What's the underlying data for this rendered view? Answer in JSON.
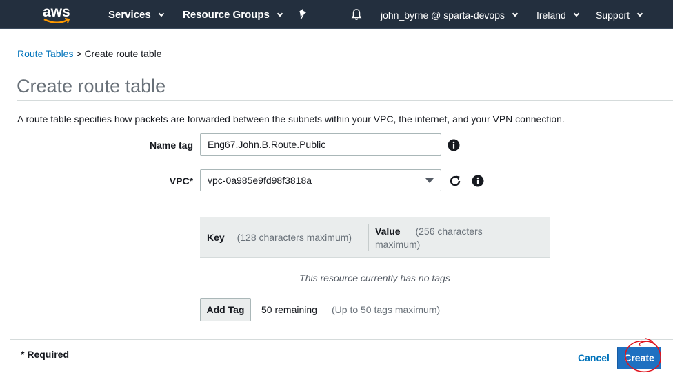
{
  "nav": {
    "logo_text": "aws",
    "services": "Services",
    "resource_groups": "Resource Groups",
    "pin_icon": "pin-icon",
    "bell_icon": "bell-icon",
    "account": "john_byrne @ sparta-devops",
    "region": "Ireland",
    "support": "Support"
  },
  "breadcrumb": {
    "parent": "Route Tables",
    "separator": ">",
    "current": "Create route table"
  },
  "page": {
    "title": "Create route table",
    "description": "A route table specifies how packets are forwarded between the subnets within your VPC, the internet, and your VPN connection."
  },
  "form": {
    "name_tag_label": "Name tag",
    "name_tag_value": "Eng67.John.B.Route.Public",
    "vpc_label": "VPC*",
    "vpc_value": "vpc-0a985e9fd98f3818a",
    "info_icon": "info-icon",
    "refresh_icon": "refresh-icon"
  },
  "tags": {
    "key_label": "Key",
    "key_hint": "(128 characters maximum)",
    "value_label": "Value",
    "value_hint_1": "(256 characters",
    "value_hint_2": "maximum)",
    "empty_message": "This resource currently has no tags",
    "add_tag": "Add Tag",
    "remaining": "50 remaining",
    "limit_hint": "(Up to 50 tags maximum)"
  },
  "footer": {
    "required": "* Required",
    "cancel": "Cancel",
    "create": "Create"
  },
  "colors": {
    "nav_bg": "#232f3e",
    "link": "#0073bb",
    "primary": "#1f70c1",
    "annotation": "#e0141e"
  }
}
